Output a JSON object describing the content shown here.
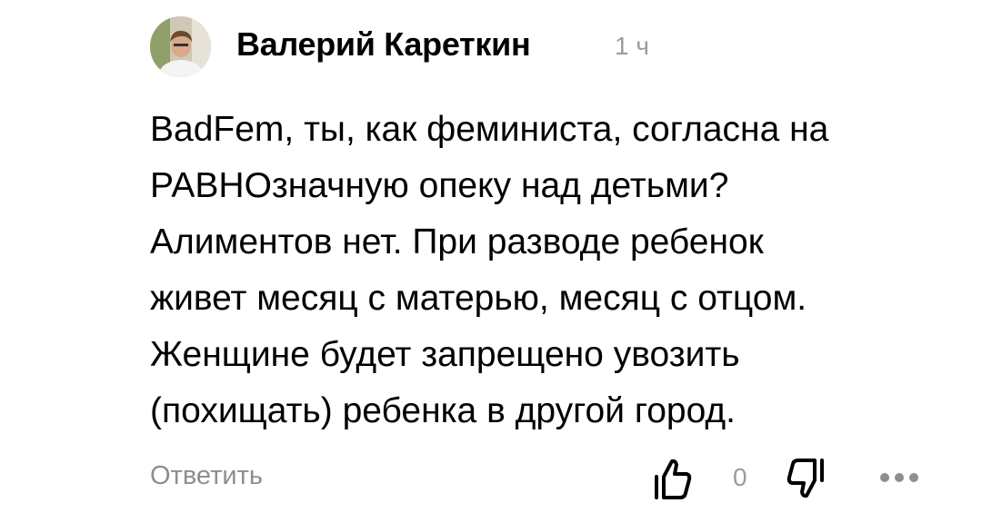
{
  "comment": {
    "author": "Валерий Кареткин",
    "time": "1 ч",
    "lines": [
      "BadFem, ты, как феминиста, согласна на",
      "РАВНОзначную опеку над детьми?",
      "Алиментов нет. При разводе ребенок",
      "живет месяц с матерью, месяц с отцом.",
      "Женщине будет запрещено увозить",
      "(похищать) ребенка в другой город."
    ],
    "reply_label": "Ответить",
    "like_count": "0"
  },
  "icons": {
    "avatar": "avatar-photo",
    "like": "thumbs-up-icon",
    "dislike": "thumbs-down-icon",
    "more": "more-dots-icon"
  },
  "colors": {
    "text": "#000000",
    "muted": "#9b9b9b"
  }
}
